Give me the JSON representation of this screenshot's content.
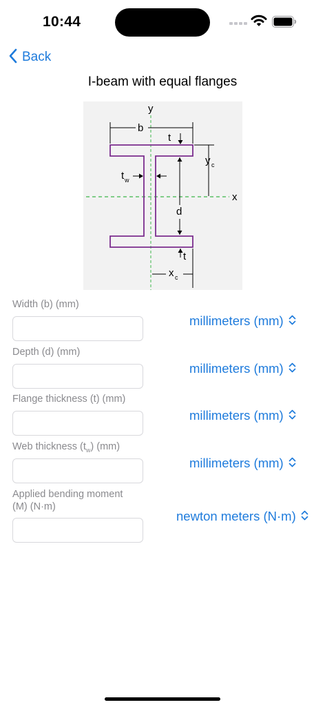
{
  "status": {
    "time": "10:44"
  },
  "nav": {
    "back_label": "Back"
  },
  "page": {
    "title": "I-beam with equal flanges"
  },
  "diagram": {
    "labels": {
      "y": "y",
      "x": "x",
      "b": "b",
      "t_top": "t",
      "yc": "y",
      "yc_sub": "c",
      "tw": "t",
      "tw_sub": "w",
      "d": "d",
      "t_bottom": "t",
      "xc": "x",
      "xc_sub": "c"
    }
  },
  "fields": [
    {
      "label": "Width (b) (mm)",
      "value": "",
      "unit": "millimeters (mm)"
    },
    {
      "label": "Depth (d) (mm)",
      "value": "",
      "unit": "millimeters (mm)"
    },
    {
      "label": "Flange thickness (t) (mm)",
      "value": "",
      "unit": "millimeters (mm)"
    },
    {
      "label_main": "Web thickness (t",
      "label_sub": "w",
      "label_end": ") (mm)",
      "value": "",
      "unit": "millimeters (mm)"
    },
    {
      "label": "Applied bending moment (M) (N·m)",
      "value": "",
      "unit": "newton meters (N·m)"
    }
  ],
  "colors": {
    "accent": "#1e7bdc",
    "beam_outline": "#7b2d8e",
    "axis_dash": "#3db54a",
    "label_gray": "#8a8a8e"
  },
  "icons": {
    "back": "chevron-left-icon",
    "unit_picker": "chevron-up-down-icon"
  }
}
